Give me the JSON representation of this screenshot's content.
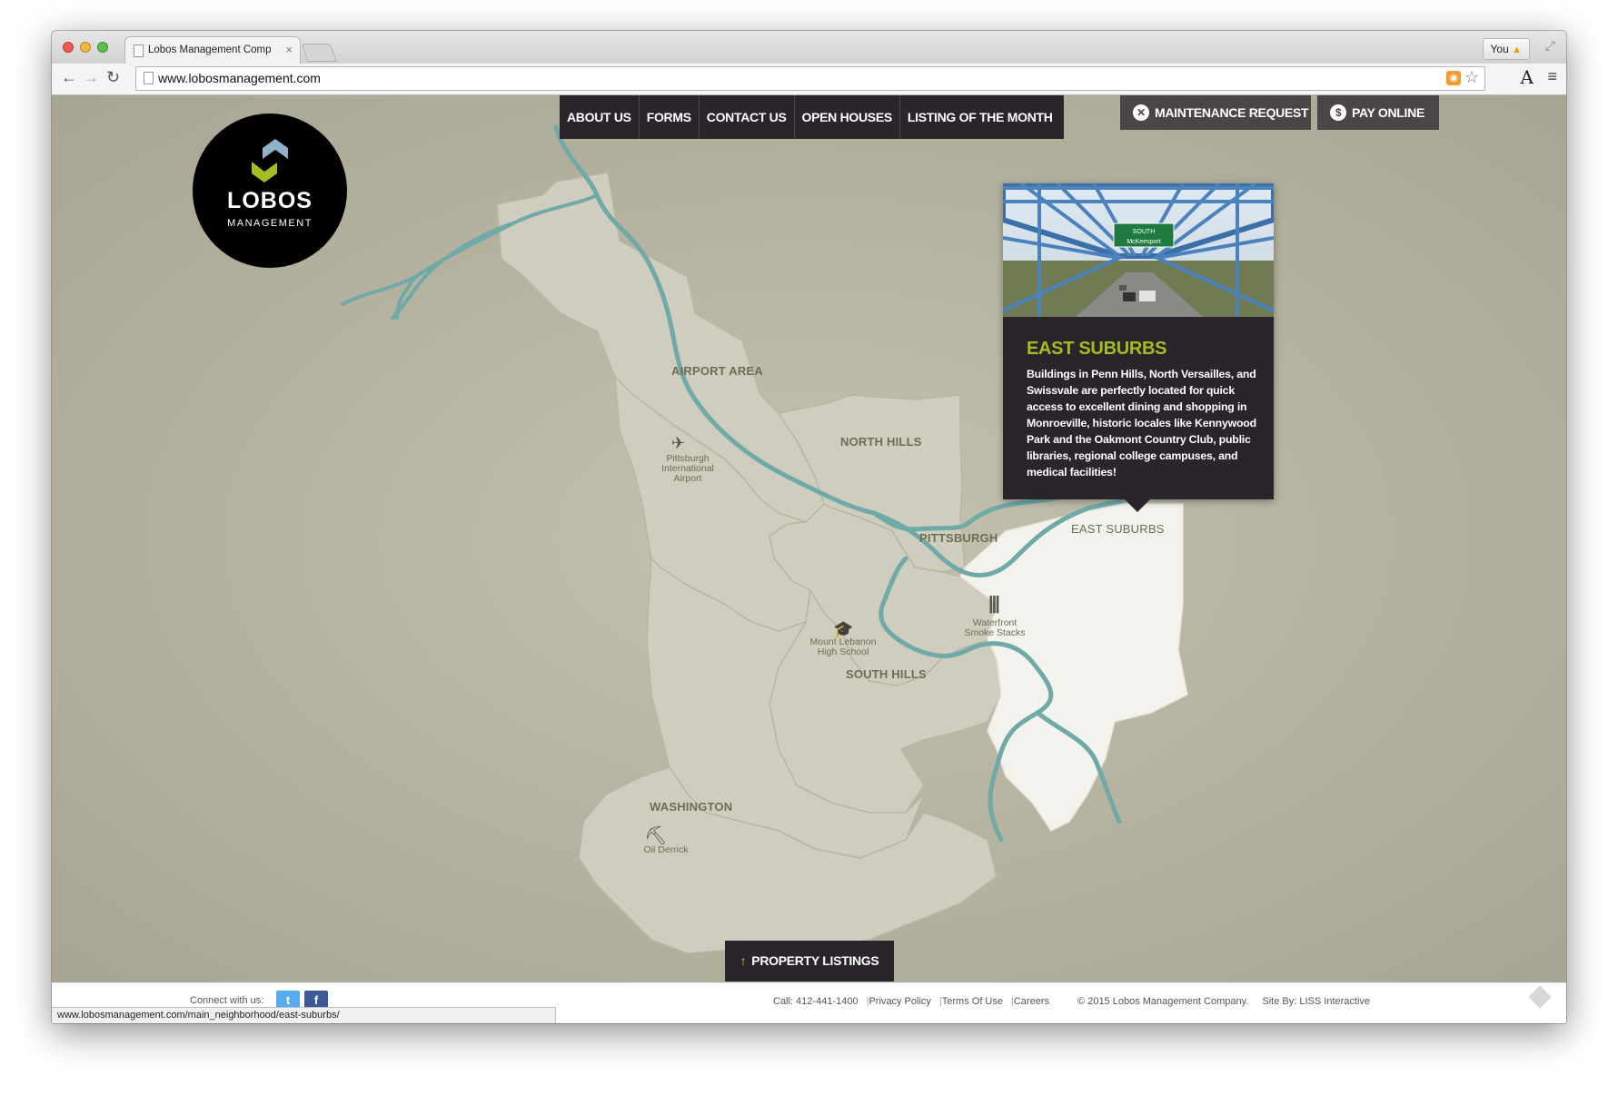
{
  "browser": {
    "tab_title": "Lobos Management Comp",
    "tab_close": "×",
    "user_button": "You",
    "url": "www.lobosmanagement.com",
    "status_url": "www.lobosmanagement.com/main_neighborhood/east-suburbs/"
  },
  "site": {
    "logo": {
      "name": "LOBOS",
      "subtitle": "MANAGEMENT"
    },
    "nav": [
      {
        "label": "ABOUT US"
      },
      {
        "label": "FORMS"
      },
      {
        "label": "CONTACT US"
      },
      {
        "label": "OPEN HOUSES"
      },
      {
        "label": "LISTING OF THE MONTH"
      }
    ],
    "actions": {
      "maintenance": {
        "label": "MAINTENANCE REQUEST",
        "icon": "wrench-icon"
      },
      "pay": {
        "label": "PAY ONLINE",
        "icon": "dollar-icon"
      }
    },
    "map": {
      "regions": {
        "airport_area": "AIRPORT AREA",
        "north_hills": "NORTH HILLS",
        "pittsburgh": "PITTSBURGH",
        "east_suburbs": "EAST SUBURBS",
        "south_hills": "SOUTH HILLS",
        "washington": "WASHINGTON"
      },
      "landmarks": {
        "airport": [
          "Pittsburgh",
          "International",
          "Airport"
        ],
        "school": [
          "Mount Lebanon",
          "High School"
        ],
        "stacks": [
          "Waterfront",
          "Smoke Stacks"
        ],
        "derrick": [
          "Oil Derrick"
        ]
      },
      "selected_region": "east_suburbs"
    },
    "popup": {
      "title": "EAST SUBURBS",
      "body": "Buildings in Penn Hills, North Versailles, and Swissvale are perfectly located for quick access to excellent dining and shopping in Monroeville, historic locales like Kennywood Park and the Oakmont Country Club, public libraries, regional college campuses, and medical facilities!",
      "sign_text": [
        "SOUTH",
        "McKeesport"
      ]
    },
    "property_listings": "PROPERTY LISTINGS",
    "footer": {
      "connect": "Connect with us:",
      "twitter": "t",
      "facebook": "f",
      "call": "Call: 412-441-1400",
      "privacy": "Privacy Policy",
      "terms": "Terms Of Use",
      "careers": "Careers",
      "copyright": "© 2015 Lobos Management Company.",
      "site_by_label": "Site By:",
      "site_by": "LISS Interactive"
    }
  },
  "colors": {
    "map_bg": "#b7b5a1",
    "region_fill": "#cfcdbd",
    "selected_region": "#f3f2ec",
    "river": "#6fa9a8",
    "dark_panel": "#29252a",
    "accent_green": "#a4bd21",
    "twitter": "#55acee",
    "facebook": "#3b5998"
  }
}
